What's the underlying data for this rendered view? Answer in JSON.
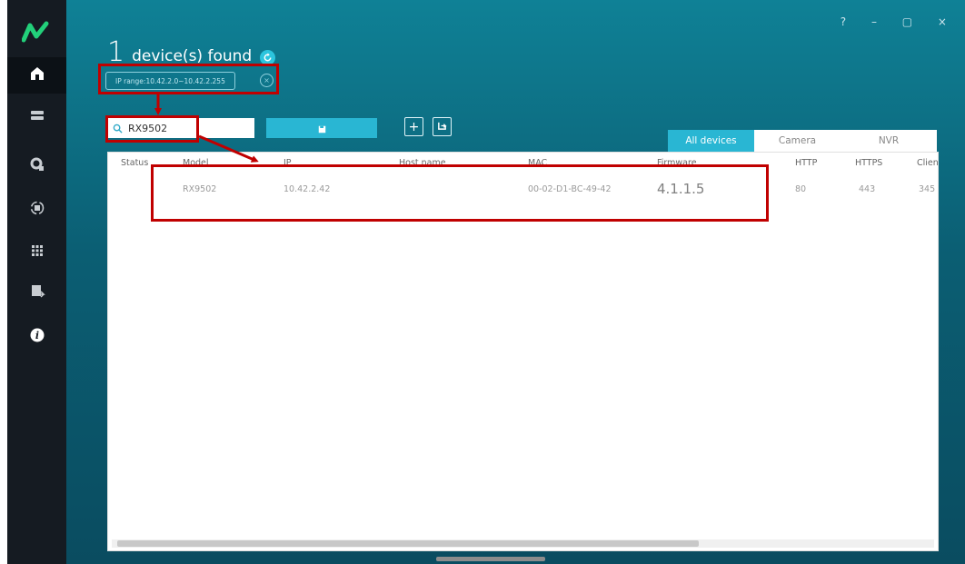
{
  "app": {
    "window_controls": "? – ▢ ×",
    "header": {
      "count": "1",
      "title": "device(s) found"
    },
    "ip_range": "IP range:10.42.2.0~10.42.2.255",
    "search": {
      "value": "RX9502"
    },
    "tabs": [
      {
        "label": "All devices",
        "active": true
      },
      {
        "label": "Camera",
        "active": false
      },
      {
        "label": "NVR",
        "active": false
      }
    ],
    "table": {
      "headers": [
        "Status",
        "Model",
        "IP",
        "Host name",
        "MAC",
        "Firmware",
        "HTTP",
        "HTTPS",
        "Clien"
      ],
      "rows": [
        {
          "status": "",
          "model": "RX9502",
          "ip": "10.42.2.42",
          "host_name": "",
          "mac": "00-02-D1-BC-49-42",
          "firmware": "4.1.1.5",
          "http": "80",
          "https": "443",
          "client": "345"
        }
      ]
    },
    "sidebar_icons": [
      "home-icon",
      "device-stack-icon",
      "settings-icon",
      "upgrade-icon",
      "grid-icon",
      "export-icon",
      "info-icon"
    ],
    "colors": {
      "accent": "#29b6d3",
      "sidebar": "#151b22",
      "header_bg": "#0b6a80",
      "annotation": "#c00000"
    }
  }
}
